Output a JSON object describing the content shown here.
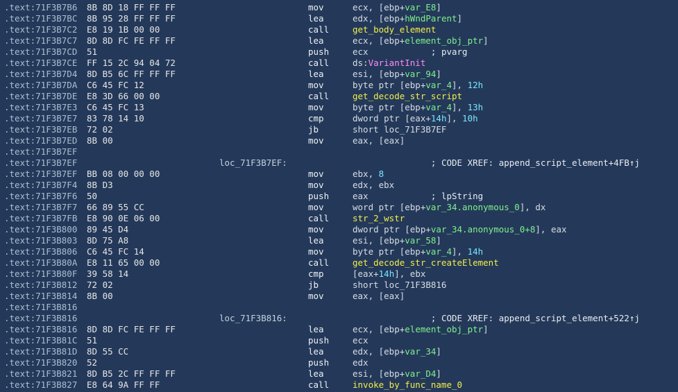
{
  "colors": {
    "background": "#24395a",
    "address": "#a9bfd2",
    "local_var": "#7ff08c",
    "function_name": "#f2ee4a",
    "import_name": "#ff8cf3",
    "number": "#79e6ff"
  },
  "rows": [
    {
      "addr": ".text:71F3B7B6",
      "bytes": "8B 8D 18 FF FF FF",
      "label": "",
      "mnem": "mov",
      "ops": [
        {
          "t": "ecx, [ebp+",
          "c": ""
        },
        {
          "t": "var_E8",
          "c": "lv"
        },
        {
          "t": "]",
          "c": ""
        }
      ]
    },
    {
      "addr": ".text:71F3B7BC",
      "bytes": "8B 95 28 FF FF FF",
      "label": "",
      "mnem": "lea",
      "ops": [
        {
          "t": "edx, [ebp+",
          "c": ""
        },
        {
          "t": "hWndParent",
          "c": "lv"
        },
        {
          "t": "]",
          "c": ""
        }
      ]
    },
    {
      "addr": ".text:71F3B7C2",
      "bytes": "E8 19 1B 00 00",
      "label": "",
      "mnem": "call",
      "ops": [
        {
          "t": "get_body_element",
          "c": "fn"
        }
      ]
    },
    {
      "addr": ".text:71F3B7C7",
      "bytes": "8D 8D FC FE FF FF",
      "label": "",
      "mnem": "lea",
      "ops": [
        {
          "t": "ecx, [ebp+",
          "c": ""
        },
        {
          "t": "element_obj_ptr",
          "c": "lv"
        },
        {
          "t": "]",
          "c": ""
        }
      ]
    },
    {
      "addr": ".text:71F3B7CD",
      "bytes": "51",
      "label": "",
      "mnem": "push",
      "ops": [
        {
          "t": "ecx            ",
          "c": ""
        },
        {
          "t": "; pvarg",
          "c": "cmt"
        }
      ]
    },
    {
      "addr": ".text:71F3B7CE",
      "bytes": "FF 15 2C 94 04 72",
      "label": "",
      "mnem": "call",
      "ops": [
        {
          "t": "ds:",
          "c": ""
        },
        {
          "t": "VariantInit",
          "c": "imp"
        }
      ]
    },
    {
      "addr": ".text:71F3B7D4",
      "bytes": "8D B5 6C FF FF FF",
      "label": "",
      "mnem": "lea",
      "ops": [
        {
          "t": "esi, [ebp+",
          "c": ""
        },
        {
          "t": "var_94",
          "c": "lv"
        },
        {
          "t": "]",
          "c": ""
        }
      ]
    },
    {
      "addr": ".text:71F3B7DA",
      "bytes": "C6 45 FC 12",
      "label": "",
      "mnem": "mov",
      "ops": [
        {
          "t": "byte ptr [ebp+",
          "c": ""
        },
        {
          "t": "var_4",
          "c": "lv"
        },
        {
          "t": "], ",
          "c": ""
        },
        {
          "t": "12h",
          "c": "num"
        }
      ]
    },
    {
      "addr": ".text:71F3B7DE",
      "bytes": "E8 3D 66 00 00",
      "label": "",
      "mnem": "call",
      "ops": [
        {
          "t": "get_decode_str_script",
          "c": "fn"
        }
      ]
    },
    {
      "addr": ".text:71F3B7E3",
      "bytes": "C6 45 FC 13",
      "label": "",
      "mnem": "mov",
      "ops": [
        {
          "t": "byte ptr [ebp+",
          "c": ""
        },
        {
          "t": "var_4",
          "c": "lv"
        },
        {
          "t": "], ",
          "c": ""
        },
        {
          "t": "13h",
          "c": "num"
        }
      ]
    },
    {
      "addr": ".text:71F3B7E7",
      "bytes": "83 78 14 10",
      "label": "",
      "mnem": "cmp",
      "ops": [
        {
          "t": "dword ptr [eax+",
          "c": ""
        },
        {
          "t": "14h",
          "c": "num"
        },
        {
          "t": "], ",
          "c": ""
        },
        {
          "t": "10h",
          "c": "num"
        }
      ]
    },
    {
      "addr": ".text:71F3B7EB",
      "bytes": "72 02",
      "label": "",
      "mnem": "jb",
      "ops": [
        {
          "t": "short loc_71F3B7EF",
          "c": ""
        }
      ]
    },
    {
      "addr": ".text:71F3B7ED",
      "bytes": "8B 00",
      "label": "",
      "mnem": "mov",
      "ops": [
        {
          "t": "eax, [eax]",
          "c": ""
        }
      ]
    },
    {
      "addr": ".text:71F3B7EF",
      "bytes": "",
      "label": "",
      "mnem": "",
      "ops": []
    },
    {
      "addr": ".text:71F3B7EF",
      "bytes": "",
      "label": "loc_71F3B7EF:",
      "mnem": "",
      "ops": [
        {
          "t": "               ",
          "c": ""
        },
        {
          "t": "; CODE XREF: append_script_element+4FB↑j",
          "c": "cmt"
        }
      ]
    },
    {
      "addr": ".text:71F3B7EF",
      "bytes": "BB 08 00 00 00",
      "label": "",
      "mnem": "mov",
      "ops": [
        {
          "t": "ebx, ",
          "c": ""
        },
        {
          "t": "8",
          "c": "num"
        }
      ]
    },
    {
      "addr": ".text:71F3B7F4",
      "bytes": "8B D3",
      "label": "",
      "mnem": "mov",
      "ops": [
        {
          "t": "edx, ebx",
          "c": ""
        }
      ]
    },
    {
      "addr": ".text:71F3B7F6",
      "bytes": "50",
      "label": "",
      "mnem": "push",
      "ops": [
        {
          "t": "eax            ",
          "c": ""
        },
        {
          "t": "; lpString",
          "c": "cmt"
        }
      ]
    },
    {
      "addr": ".text:71F3B7F7",
      "bytes": "66 89 55 CC",
      "label": "",
      "mnem": "mov",
      "ops": [
        {
          "t": "word ptr [ebp+",
          "c": ""
        },
        {
          "t": "var_34.anonymous_0",
          "c": "lv"
        },
        {
          "t": "], dx",
          "c": ""
        }
      ]
    },
    {
      "addr": ".text:71F3B7FB",
      "bytes": "E8 90 0E 06 00",
      "label": "",
      "mnem": "call",
      "ops": [
        {
          "t": "str_2_wstr",
          "c": "fn"
        }
      ]
    },
    {
      "addr": ".text:71F3B800",
      "bytes": "89 45 D4",
      "label": "",
      "mnem": "mov",
      "ops": [
        {
          "t": "dword ptr [ebp+",
          "c": ""
        },
        {
          "t": "var_34.anonymous_0+8",
          "c": "lv"
        },
        {
          "t": "], eax",
          "c": ""
        }
      ]
    },
    {
      "addr": ".text:71F3B803",
      "bytes": "8D 75 A8",
      "label": "",
      "mnem": "lea",
      "ops": [
        {
          "t": "esi, [ebp+",
          "c": ""
        },
        {
          "t": "var_58",
          "c": "lv"
        },
        {
          "t": "]",
          "c": ""
        }
      ]
    },
    {
      "addr": ".text:71F3B806",
      "bytes": "C6 45 FC 14",
      "label": "",
      "mnem": "mov",
      "ops": [
        {
          "t": "byte ptr [ebp+",
          "c": ""
        },
        {
          "t": "var_4",
          "c": "lv"
        },
        {
          "t": "], ",
          "c": ""
        },
        {
          "t": "14h",
          "c": "num"
        }
      ]
    },
    {
      "addr": ".text:71F3B80A",
      "bytes": "E8 11 65 00 00",
      "label": "",
      "mnem": "call",
      "ops": [
        {
          "t": "get_decode_str_createElement",
          "c": "fn"
        }
      ]
    },
    {
      "addr": ".text:71F3B80F",
      "bytes": "39 58 14",
      "label": "",
      "mnem": "cmp",
      "ops": [
        {
          "t": "[eax+",
          "c": ""
        },
        {
          "t": "14h",
          "c": "num"
        },
        {
          "t": "], ebx",
          "c": ""
        }
      ]
    },
    {
      "addr": ".text:71F3B812",
      "bytes": "72 02",
      "label": "",
      "mnem": "jb",
      "ops": [
        {
          "t": "short loc_71F3B816",
          "c": ""
        }
      ]
    },
    {
      "addr": ".text:71F3B814",
      "bytes": "8B 00",
      "label": "",
      "mnem": "mov",
      "ops": [
        {
          "t": "eax, [eax]",
          "c": ""
        }
      ]
    },
    {
      "addr": ".text:71F3B816",
      "bytes": "",
      "label": "",
      "mnem": "",
      "ops": []
    },
    {
      "addr": ".text:71F3B816",
      "bytes": "",
      "label": "loc_71F3B816:",
      "mnem": "",
      "ops": [
        {
          "t": "               ",
          "c": ""
        },
        {
          "t": "; CODE XREF: append_script_element+522↑j",
          "c": "cmt"
        }
      ]
    },
    {
      "addr": ".text:71F3B816",
      "bytes": "8D 8D FC FE FF FF",
      "label": "",
      "mnem": "lea",
      "ops": [
        {
          "t": "ecx, [ebp+",
          "c": ""
        },
        {
          "t": "element_obj_ptr",
          "c": "lv"
        },
        {
          "t": "]",
          "c": ""
        }
      ]
    },
    {
      "addr": ".text:71F3B81C",
      "bytes": "51",
      "label": "",
      "mnem": "push",
      "ops": [
        {
          "t": "ecx",
          "c": ""
        }
      ]
    },
    {
      "addr": ".text:71F3B81D",
      "bytes": "8D 55 CC",
      "label": "",
      "mnem": "lea",
      "ops": [
        {
          "t": "edx, [ebp+",
          "c": ""
        },
        {
          "t": "var_34",
          "c": "lv"
        },
        {
          "t": "]",
          "c": ""
        }
      ]
    },
    {
      "addr": ".text:71F3B820",
      "bytes": "52",
      "label": "",
      "mnem": "push",
      "ops": [
        {
          "t": "edx",
          "c": ""
        }
      ]
    },
    {
      "addr": ".text:71F3B821",
      "bytes": "8D B5 2C FF FF FF",
      "label": "",
      "mnem": "lea",
      "ops": [
        {
          "t": "esi, [ebp+",
          "c": ""
        },
        {
          "t": "var_D4",
          "c": "lv"
        },
        {
          "t": "]",
          "c": ""
        }
      ]
    },
    {
      "addr": ".text:71F3B827",
      "bytes": "E8 64 9A FF FF",
      "label": "",
      "mnem": "call",
      "ops": [
        {
          "t": "invoke_by_func_name_0",
          "c": "fn"
        }
      ]
    }
  ]
}
